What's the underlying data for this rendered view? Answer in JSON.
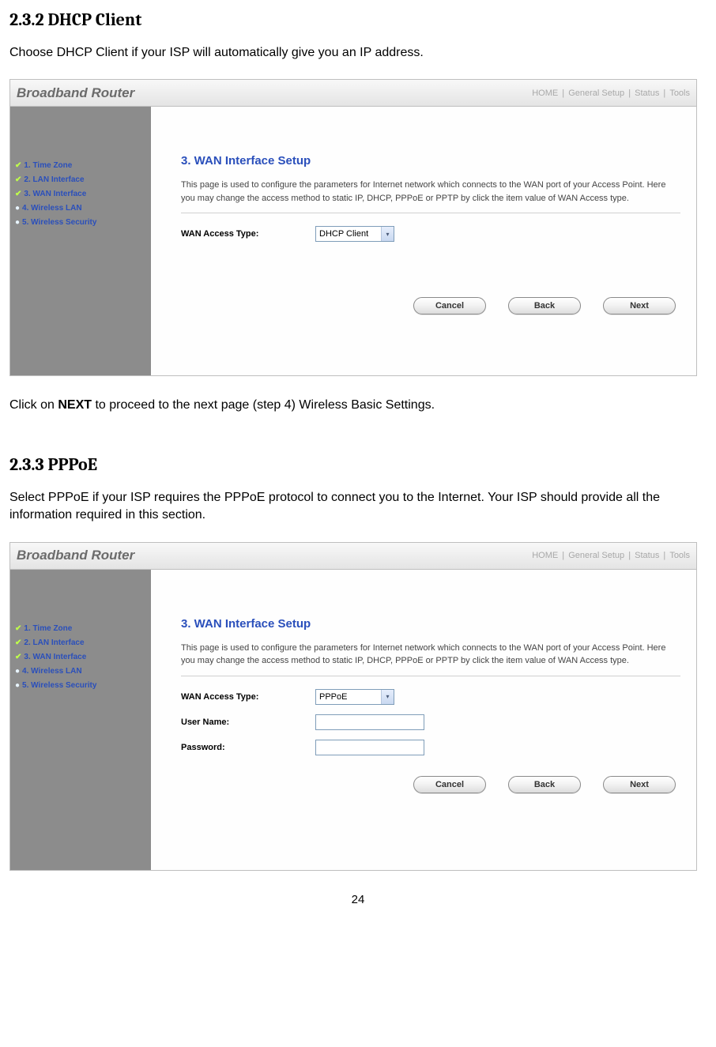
{
  "doc": {
    "h1": "2.3.2 DHCP Client",
    "p1": "Choose DHCP Client if your ISP will automatically give you an IP address.",
    "p2_pre": "Click on ",
    "p2_bold": "NEXT",
    "p2_post": " to proceed to the next page (step 4) Wireless Basic Settings.",
    "h2": "2.3.3 PPPoE",
    "p3": "Select PPPoE if your ISP requires the PPPoE protocol to connect you to the Internet. Your ISP should provide all the information required in this section.",
    "page_number": "24"
  },
  "router": {
    "brand": "Broadband Router",
    "nav": {
      "home": "HOME",
      "general": "General Setup",
      "status": "Status",
      "tools": "Tools"
    },
    "sidebar": [
      {
        "label": "1. Time Zone",
        "done": true
      },
      {
        "label": "2. LAN Interface",
        "done": true
      },
      {
        "label": "3. WAN Interface",
        "done": true
      },
      {
        "label": "4. Wireless LAN",
        "done": false
      },
      {
        "label": "5. Wireless Security",
        "done": false
      }
    ],
    "main_title": "3. WAN Interface Setup",
    "main_desc": "This page is used to configure the parameters for Internet network which connects to the WAN port of your Access Point. Here you may change the access method to static IP, DHCP, PPPoE or PPTP by click the item value of WAN Access type.",
    "labels": {
      "wan_access": "WAN Access Type:",
      "username": "User Name:",
      "password": "Password:"
    },
    "values": {
      "dhcp": "DHCP Client",
      "pppoe": "PPPoE",
      "username": "",
      "password": ""
    },
    "buttons": {
      "cancel": "Cancel",
      "back": "Back",
      "next": "Next"
    }
  }
}
